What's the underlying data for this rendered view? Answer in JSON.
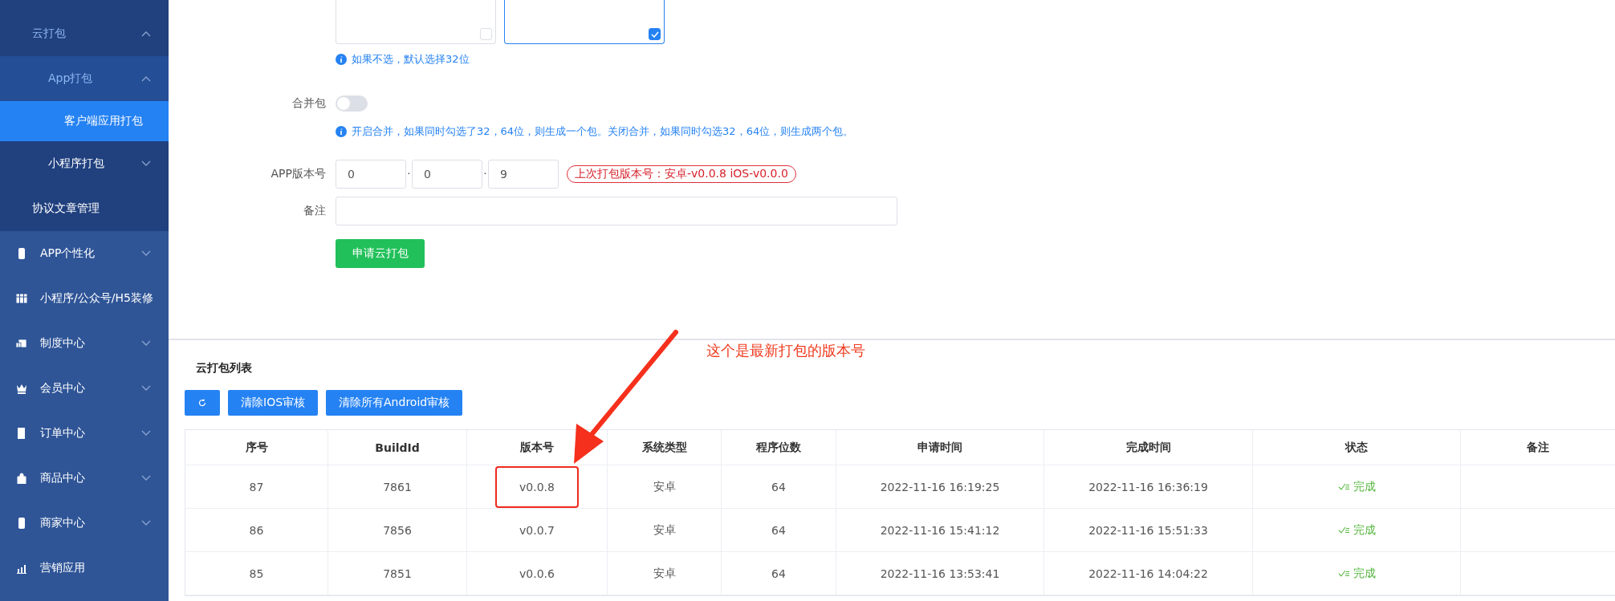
{
  "sidebar": {
    "submenu": [
      {
        "label": "云打包",
        "expanded": true,
        "children": [
          {
            "label": "App打包",
            "expanded": true,
            "children": [
              {
                "label": "客户端应用打包",
                "selected": true
              }
            ]
          },
          {
            "label": "小程序打包",
            "expanded": false
          }
        ]
      },
      {
        "label": "协议文章管理",
        "selected": false
      }
    ],
    "items": [
      {
        "label": "APP个性化",
        "expanded": false
      },
      {
        "label": "小程序/公众号/H5装修"
      },
      {
        "label": "制度中心",
        "expanded": false
      },
      {
        "label": "会员中心",
        "expanded": false
      },
      {
        "label": "订单中心",
        "expanded": false
      },
      {
        "label": "商品中心",
        "expanded": false
      },
      {
        "label": "商家中心",
        "expanded": false
      },
      {
        "label": "营销应用"
      }
    ]
  },
  "form": {
    "arch_options": [
      {
        "checked": false
      },
      {
        "checked": true
      }
    ],
    "arch_hint": "如果不选，默认选择32位",
    "merge": {
      "label": "合并包",
      "on": false,
      "hint": "开启合并，如果同时勾选了32，64位，则生成一个包。关闭合并，如果同时勾选32，64位，则生成两个包。"
    },
    "version": {
      "label": "APP版本号",
      "parts": [
        "0",
        "0",
        "9"
      ],
      "separator": "·",
      "last": "上次打包版本号：安卓-v0.0.8 iOS-v0.0.0"
    },
    "remark": {
      "label": "备注"
    },
    "submit": "申请云打包"
  },
  "list": {
    "title": "云打包列表",
    "buttons": [
      {
        "kind": "refresh"
      },
      {
        "kind": "text",
        "label": "清除IOS审核"
      },
      {
        "kind": "text",
        "label": "清除所有Android审核"
      }
    ],
    "columns": [
      "序号",
      "BuildId",
      "版本号",
      "系统类型",
      "程序位数",
      "申请时间",
      "完成时间",
      "状态",
      "备注"
    ],
    "rows": [
      {
        "cells": [
          "87",
          "7861",
          "v0.0.8",
          "安卓",
          "64",
          "2022-11-16 16:19:25",
          "2022-11-16 16:36:19"
        ],
        "status": {
          "kind": "done",
          "text": "完成"
        },
        "circled": true
      },
      {
        "cells": [
          "86",
          "7856",
          "v0.0.7",
          "安卓",
          "64",
          "2022-11-16 15:41:12",
          "2022-11-16 15:51:33"
        ],
        "status": {
          "kind": "done",
          "text": "完成"
        },
        "circled": false
      },
      {
        "cells": [
          "85",
          "7851",
          "v0.0.6",
          "安卓",
          "64",
          "2022-11-16 13:53:41",
          "2022-11-16 14:04:22"
        ],
        "status": {
          "kind": "done",
          "text": "完成"
        },
        "circled": false
      }
    ]
  },
  "annotation": {
    "text": "这个是最新打包的版本号"
  }
}
